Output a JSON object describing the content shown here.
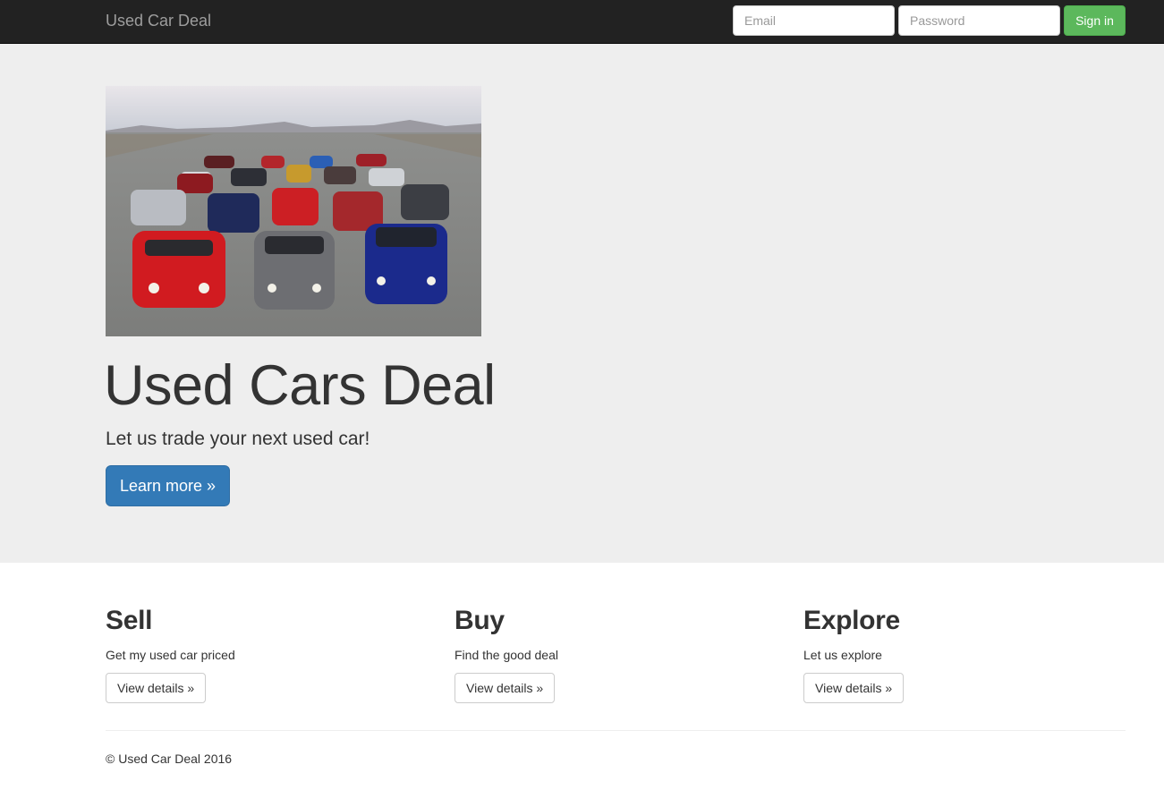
{
  "navbar": {
    "brand": "Used Car Deal",
    "email_placeholder": "Email",
    "password_placeholder": "Password",
    "signin_label": "Sign in"
  },
  "hero": {
    "title": "Used Cars Deal",
    "tagline": "Let us trade your next used car!",
    "learn_more_label": "Learn more »"
  },
  "features": [
    {
      "heading": "Sell",
      "text": "Get my used car priced",
      "button": "View details »"
    },
    {
      "heading": "Buy",
      "text": "Find the good deal",
      "button": "View details »"
    },
    {
      "heading": "Explore",
      "text": "Let us explore",
      "button": "View details »"
    }
  ],
  "footer": {
    "text": "© Used Car Deal 2016"
  },
  "colors": {
    "navbar_bg": "#222222",
    "jumbotron_bg": "#eeeeee",
    "success": "#5cb85c",
    "primary": "#337ab7"
  }
}
